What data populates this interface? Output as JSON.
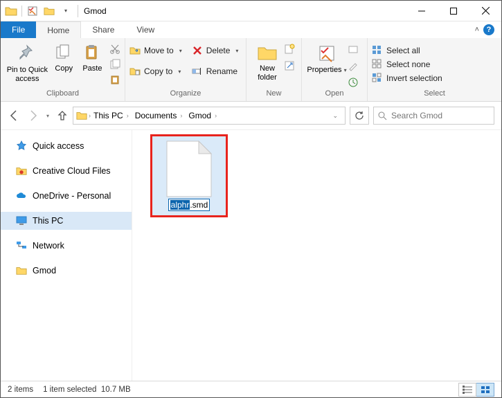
{
  "window": {
    "title": "Gmod"
  },
  "tabs": {
    "file": "File",
    "home": "Home",
    "share": "Share",
    "view": "View",
    "active": "Home"
  },
  "ribbon": {
    "clipboard": {
      "label": "Clipboard",
      "pin": "Pin to Quick access",
      "copy": "Copy",
      "paste": "Paste"
    },
    "organize": {
      "label": "Organize",
      "moveto": "Move to",
      "copyto": "Copy to",
      "delete": "Delete",
      "rename": "Rename"
    },
    "new": {
      "label": "New",
      "newfolder": "New folder"
    },
    "open": {
      "label": "Open",
      "properties": "Properties"
    },
    "select": {
      "label": "Select",
      "all": "Select all",
      "none": "Select none",
      "invert": "Invert selection"
    }
  },
  "breadcrumbs": {
    "root": "This PC",
    "p1": "Documents",
    "p2": "Gmod"
  },
  "search": {
    "placeholder": "Search Gmod"
  },
  "sidebar": {
    "items": [
      {
        "label": "Quick access"
      },
      {
        "label": "Creative Cloud Files"
      },
      {
        "label": "OneDrive - Personal"
      },
      {
        "label": "This PC"
      },
      {
        "label": "Network"
      },
      {
        "label": "Gmod"
      }
    ]
  },
  "file": {
    "rename_selected": "alphr",
    "rename_ext": ".smd"
  },
  "status": {
    "count": "2 items",
    "selected": "1 item selected",
    "size": "10.7 MB"
  }
}
